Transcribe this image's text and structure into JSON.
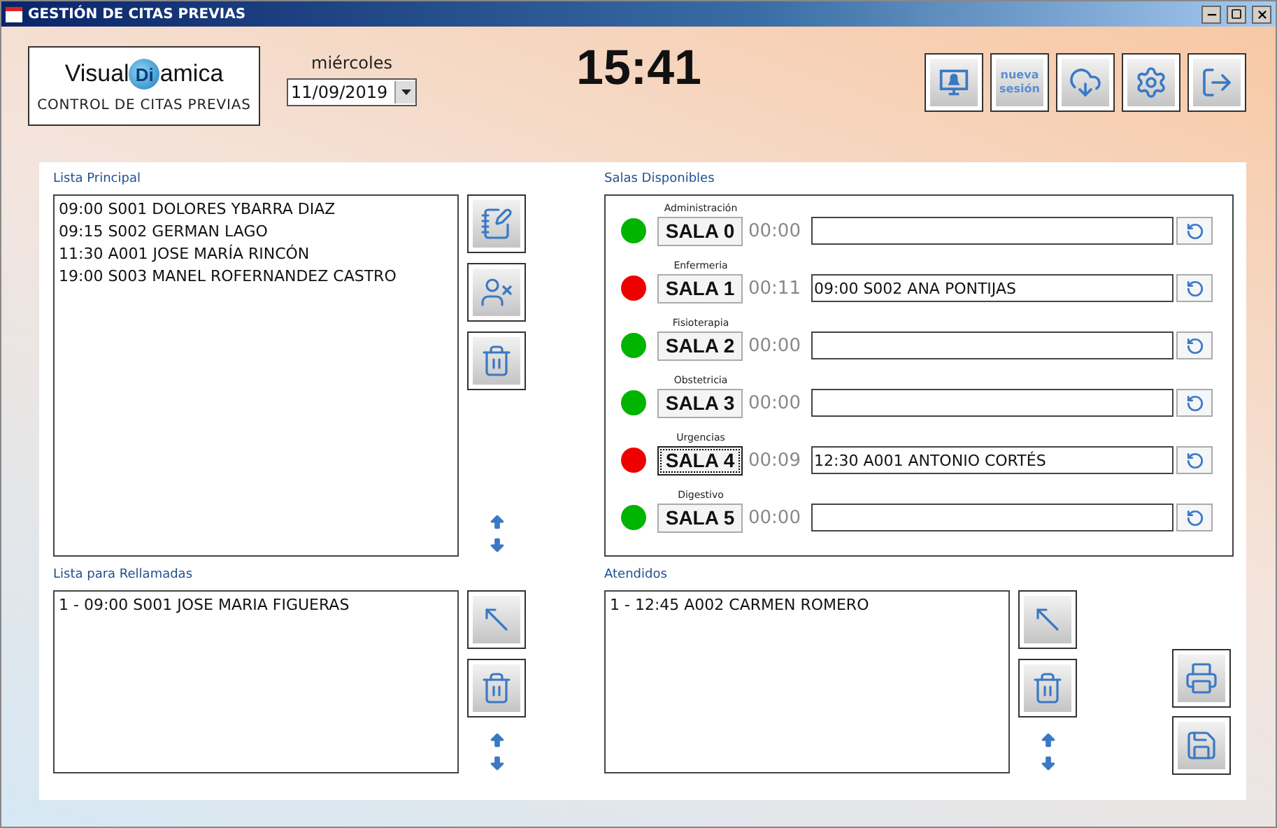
{
  "window": {
    "title": "GESTIÓN DE CITAS PREVIAS"
  },
  "logo": {
    "name_start": "Visual",
    "name_mark": "Di",
    "name_end": "amica",
    "subtitle": "CONTROL DE CITAS PREVIAS"
  },
  "date": {
    "weekday": "miércoles",
    "value": "11/09/2019"
  },
  "clock": "15:41",
  "toolbar": [
    {
      "kind": "alarm"
    },
    {
      "kind": "text",
      "label": "nueva sesión"
    },
    {
      "kind": "download"
    },
    {
      "kind": "settings"
    },
    {
      "kind": "exit"
    }
  ],
  "main_list": {
    "title": "Lista Principal",
    "items": [
      "09:00 S001 DOLORES YBARRA DIAZ",
      "09:15 S002 GERMAN LAGO",
      "11:30 A001 JOSE MARÍA RINCÓN",
      "19:00 S003 MANEL ROFERNANDEZ CASTRO"
    ]
  },
  "rooms": {
    "title": "Salas Disponibles",
    "items": [
      {
        "department": "Administración",
        "name": "SALA 0",
        "time": "00:00",
        "occupied": false,
        "focused": false
      },
      {
        "department": "Enfermeria",
        "name": "SALA 1",
        "time": "00:11",
        "patient": "09:00 S002 ANA PONTIJAS",
        "occupied": true,
        "focused": false
      },
      {
        "department": "Fisioterapia",
        "name": "SALA 2",
        "time": "00:00",
        "occupied": false,
        "focused": false
      },
      {
        "department": "Obstetricia",
        "name": "SALA 3",
        "time": "00:00",
        "occupied": false,
        "focused": false
      },
      {
        "department": "Urgencias",
        "name": "SALA 4",
        "time": "00:09",
        "patient": "12:30 A001 ANTONIO CORTÉS",
        "occupied": true,
        "focused": true
      },
      {
        "department": "Digestivo",
        "name": "SALA 5",
        "time": "00:00",
        "occupied": false,
        "focused": false
      }
    ]
  },
  "recall_list": {
    "title": "Lista para Rellamadas",
    "items": [
      "1 - 09:00 S001 JOSE MARIA FIGUERAS"
    ]
  },
  "attended_list": {
    "title": "Atendidos",
    "items": [
      "1 - 12:45 A002 CARMEN ROMERO"
    ]
  }
}
